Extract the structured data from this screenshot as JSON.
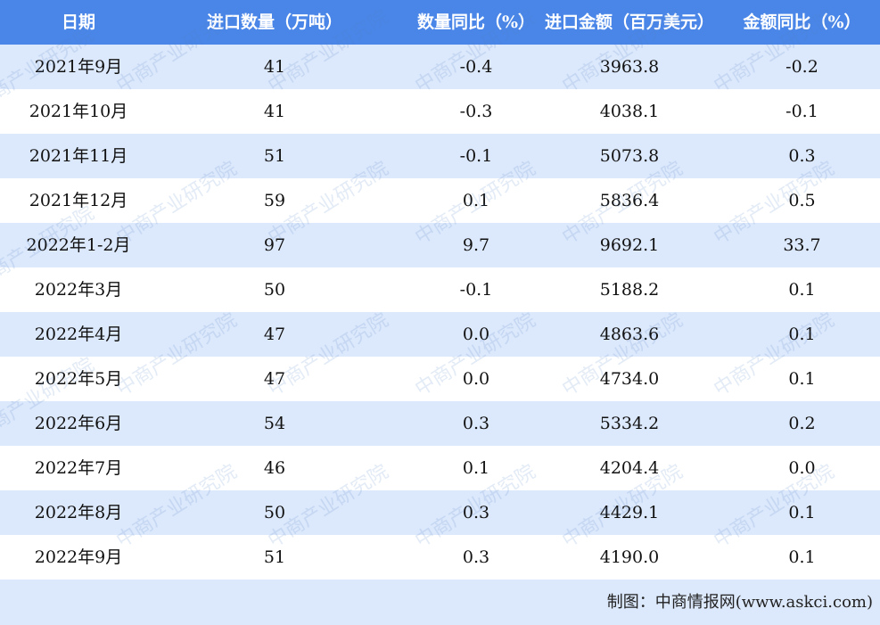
{
  "chart_data": {
    "type": "table",
    "columns": [
      "日期",
      "进口数量（万吨）",
      "数量同比（%）",
      "进口金额（百万美元）",
      "金额同比（%）"
    ],
    "rows": [
      [
        "2021年9月",
        "41",
        "-0.4",
        "3963.8",
        "-0.2"
      ],
      [
        "2021年10月",
        "41",
        "-0.3",
        "4038.1",
        "-0.1"
      ],
      [
        "2021年11月",
        "51",
        "-0.1",
        "5073.8",
        "0.3"
      ],
      [
        "2021年12月",
        "59",
        "0.1",
        "5836.4",
        "0.5"
      ],
      [
        "2022年1-2月",
        "97",
        "9.7",
        "9692.1",
        "33.7"
      ],
      [
        "2022年3月",
        "50",
        "-0.1",
        "5188.2",
        "0.1"
      ],
      [
        "2022年4月",
        "47",
        "0.0",
        "4863.6",
        "0.1"
      ],
      [
        "2022年5月",
        "47",
        "0.0",
        "4734.0",
        "0.1"
      ],
      [
        "2022年6月",
        "54",
        "0.3",
        "5334.2",
        "0.2"
      ],
      [
        "2022年7月",
        "46",
        "0.1",
        "4204.4",
        "0.0"
      ],
      [
        "2022年8月",
        "50",
        "0.3",
        "4429.1",
        "0.1"
      ],
      [
        "2022年9月",
        "51",
        "0.3",
        "4190.0",
        "0.1"
      ]
    ],
    "source": "制图：中商情报网(www.askci.com)",
    "watermark": "中商产业研究院",
    "colors": {
      "header": "#4a86e8",
      "stripe": "#dce8fb"
    }
  }
}
